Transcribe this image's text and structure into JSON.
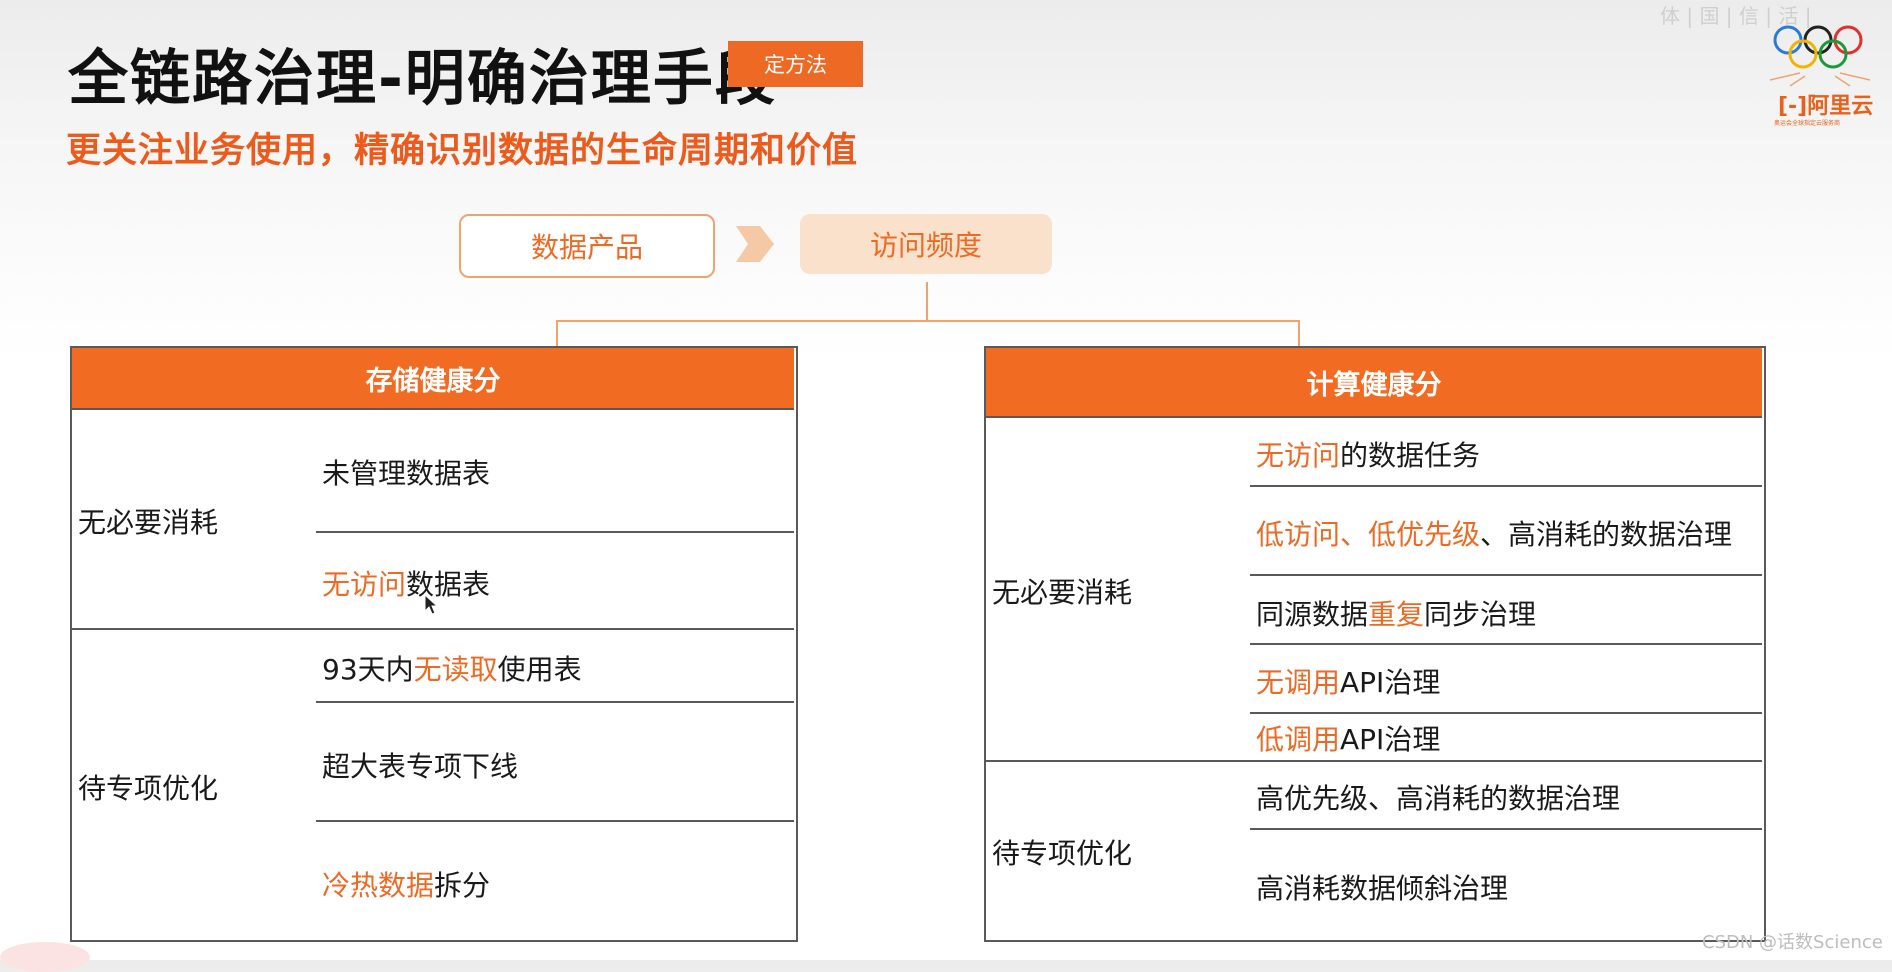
{
  "header": {
    "title": "全链路治理-明确治理手段",
    "tag": "定方法",
    "subtitle": "更关注业务使用，精确识别数据的生命周期和价值",
    "top_mark": "体 | 国 | 信 | 活 |"
  },
  "logo": {
    "text": "阿里云",
    "subtext": "奥运会全球指定云服务商"
  },
  "flow": {
    "box1": "数据产品",
    "box2": "访问频度"
  },
  "storage": {
    "title": "存储健康分",
    "groups": [
      {
        "category": "无必要消耗",
        "items": [
          {
            "pre": "未管理数据表",
            "hl": "",
            "post": ""
          },
          {
            "pre": "",
            "hl": "无访问",
            "post": "数据表"
          }
        ]
      },
      {
        "category": "待专项优化",
        "items": [
          {
            "pre": "93天内",
            "hl": "无读取",
            "post": "使用表"
          },
          {
            "pre": "超大表专项下线",
            "hl": "",
            "post": ""
          },
          {
            "pre": "",
            "hl": "冷热数据",
            "post": "拆分"
          }
        ]
      }
    ]
  },
  "compute": {
    "title": "计算健康分",
    "groups": [
      {
        "category": "无必要消耗",
        "items": [
          {
            "pre": "",
            "hl": "无访问",
            "post": "的数据任务"
          },
          {
            "pre": "",
            "hl": "低访问、低优先级",
            "post": "、高消耗的数据治理"
          },
          {
            "pre": "同源数据",
            "hl": "重复",
            "post": "同步治理"
          },
          {
            "pre": "",
            "hl": "无调用",
            "post": "API治理"
          },
          {
            "pre": "",
            "hl": "低调用",
            "post": "API治理"
          }
        ]
      },
      {
        "category": "待专项优化",
        "items": [
          {
            "pre": "高优先级、高消耗的数据治理",
            "hl": "",
            "post": ""
          },
          {
            "pre": "高消耗数据倾斜治理",
            "hl": "",
            "post": ""
          }
        ]
      }
    ]
  },
  "watermark": "CSDN @话数Science",
  "colors": {
    "accent": "#f26b22",
    "highlight": "#ec6a23",
    "subtitle": "#ec5a1c"
  }
}
